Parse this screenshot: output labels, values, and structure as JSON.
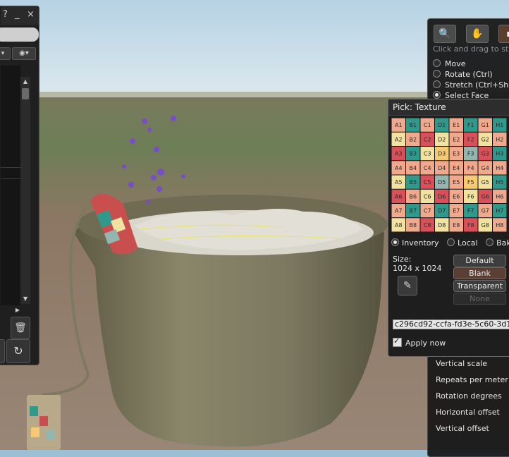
{
  "left_panel": {
    "title_help": "?",
    "title_minimize": "_",
    "title_close": "×",
    "dropdown_arrow": "▾",
    "eye_icon": "◉▾",
    "scroll_up": "▲",
    "scroll_down": "▼",
    "scroll_right": "▶",
    "trash_icon": "🗑",
    "refresh_icon": "↻"
  },
  "build_tools": {
    "tools": [
      {
        "icon": "🔍",
        "name": "focus"
      },
      {
        "icon": "✋",
        "name": "move"
      },
      {
        "icon": "▪",
        "name": "edit"
      }
    ],
    "hint": "Click and drag to stretch",
    "modes": [
      {
        "label": "Move",
        "selected": false
      },
      {
        "label": "Rotate (Ctrl)",
        "selected": false
      },
      {
        "label": "Stretch (Ctrl+Shift)",
        "selected": false
      },
      {
        "label": "Select Face",
        "selected": true
      }
    ],
    "properties": [
      "Vertical scale",
      "Repeats per meter",
      "Rotation degrees",
      "Horizontal offset",
      "Vertical offset"
    ]
  },
  "texture_picker": {
    "title": "Pick: Texture",
    "grid": {
      "columns": [
        "A",
        "B",
        "C",
        "D",
        "E",
        "F",
        "G",
        "H"
      ],
      "rows": [
        "1",
        "2",
        "3",
        "4",
        "5",
        "6",
        "7",
        "8"
      ],
      "palette": [
        "#f1a98e",
        "#f6ca73",
        "#f1e2a0",
        "#2f9a8c",
        "#d8505a",
        "#93b7b0"
      ]
    },
    "sources": [
      {
        "label": "Inventory",
        "selected": true
      },
      {
        "label": "Local",
        "selected": false
      },
      {
        "label": "Bake",
        "selected": false
      }
    ],
    "size_label": "Size:",
    "size_value": "1024 x 1024",
    "eyedropper_icon": "✎",
    "buttons": {
      "default": "Default",
      "blank": "Blank",
      "transparent": "Transparent",
      "none": "None"
    },
    "uuid": "c296cd92-ccfa-fd3e-5c60-3d1",
    "apply_now_label": "Apply now",
    "apply_now_checked": true
  }
}
